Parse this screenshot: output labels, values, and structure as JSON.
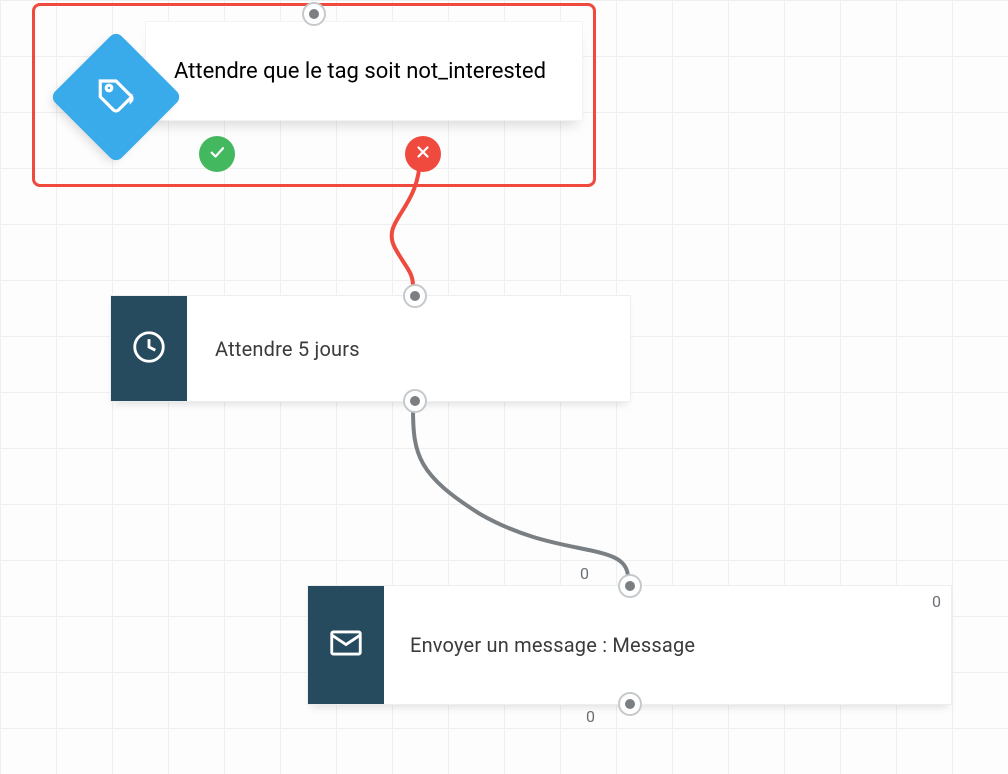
{
  "condition_node": {
    "label": "Attendre que le tag soit not_interested",
    "icon": "tag-icon",
    "selected": true,
    "outcomes": {
      "yes": true,
      "no": true
    }
  },
  "wait_node": {
    "label": "Attendre 5 jours",
    "icon": "clock-icon"
  },
  "message_node": {
    "label": "Envoyer un message : Message",
    "icon": "mail-icon",
    "counter_top_left": "0",
    "counter_top_right": "0",
    "counter_bottom": "0"
  }
}
